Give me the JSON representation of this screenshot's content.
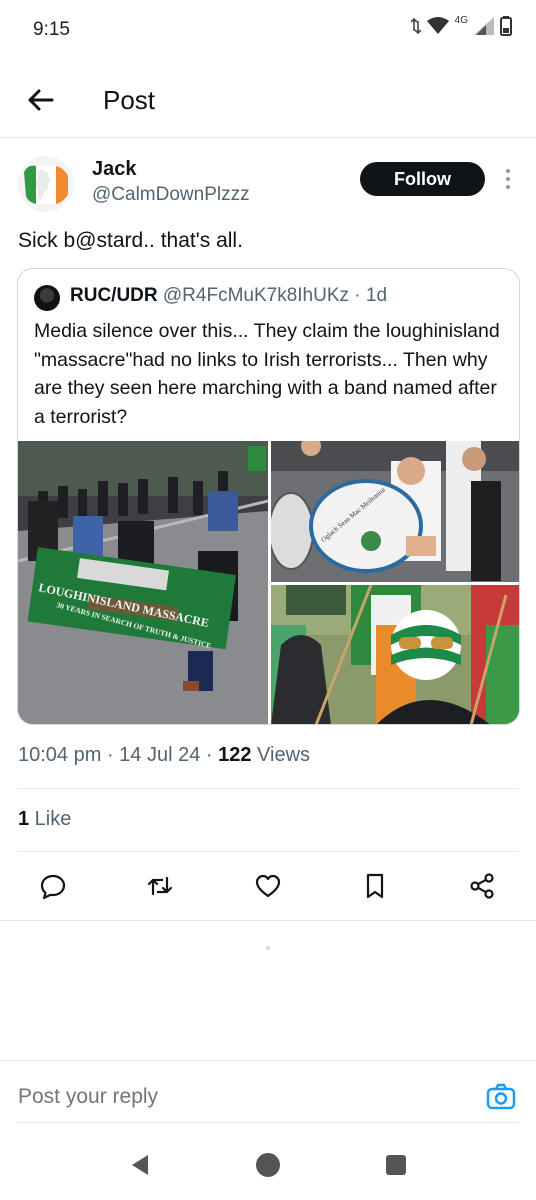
{
  "status_bar": {
    "time": "9:15",
    "network": "4G",
    "icons": [
      "data-arrows-icon",
      "wifi-icon",
      "signal-icon",
      "battery-icon"
    ]
  },
  "header": {
    "title": "Post",
    "back_icon": "arrow-left-icon"
  },
  "post": {
    "author": {
      "name": "Jack",
      "handle": "@CalmDownPlzzz",
      "avatar": "irish-flag-avatar"
    },
    "follow_label": "Follow",
    "text": "Sick b@stard.. that's all.",
    "quoted": {
      "name": "RUC/UDR",
      "handle": "@R4FcMuK7k8IhUKz",
      "age": "· 1d",
      "text": "Media silence over this... They claim the loughinisland \"massacre\"had no links to Irish terrorists... Then why are they seen here marching with a band named after a terrorist?",
      "media": [
        {
          "banner_line1": "LOUGHINISLAND MASSACRE",
          "banner_line2": "30 YEARS IN SEARCH OF TRUTH & JUSTICE"
        },
        {
          "drum_text": "Oglach Sean Mac Meileanna"
        },
        {
          "description": ""
        }
      ]
    },
    "time": "10:04 pm · 14 Jul 24 · ",
    "views_count": "122",
    "views_label": " Views",
    "likes_count": "1",
    "likes_label": " Like",
    "actions": [
      "reply-icon",
      "repost-icon",
      "like-icon",
      "bookmark-icon",
      "share-icon"
    ]
  },
  "reply": {
    "placeholder": "Post your reply"
  },
  "colors": {
    "text": "#0f1419",
    "muted": "#536471",
    "accent": "#1d9bf0",
    "border": "#cfd9de"
  }
}
